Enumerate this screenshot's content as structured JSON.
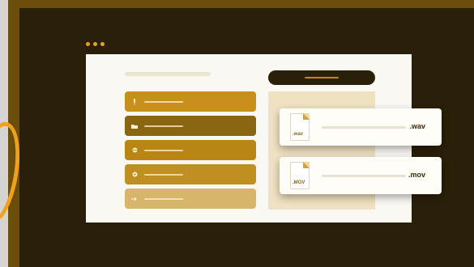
{
  "files": [
    {
      "doc_label": ".wav",
      "ext": ".wav"
    },
    {
      "doc_label": ".MOV",
      "ext": ".mov"
    }
  ],
  "menu": {
    "items": [
      {
        "icon": "microphone-icon",
        "color": "#c88f1a"
      },
      {
        "icon": "folder-icon",
        "color": "#8a6512"
      },
      {
        "icon": "globe-icon",
        "color": "#b98616"
      },
      {
        "icon": "settings-icon",
        "color": "#c08f22"
      },
      {
        "icon": "arrow-right-icon",
        "color": "#d8b56a"
      }
    ]
  },
  "colors": {
    "accent": "#e9a020",
    "dark": "#2a1f08",
    "frame": "#6b4d0c"
  }
}
